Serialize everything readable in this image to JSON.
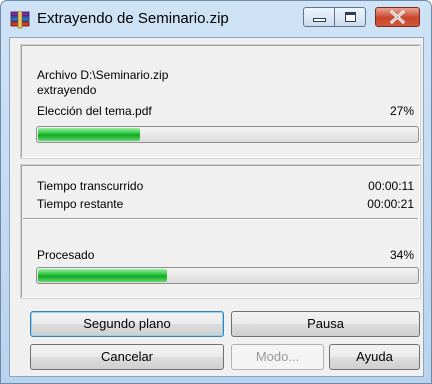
{
  "window": {
    "title": "Extrayendo de Seminario.zip"
  },
  "archive_line": "Archivo D:\\Seminario.zip",
  "action_line": "extrayendo",
  "current_file": {
    "name": "Elección del tema.pdf",
    "percent_label": "27%",
    "progress": 0.27
  },
  "times": {
    "elapsed_label": "Tiempo transcurrido",
    "elapsed_value": "00:00:11",
    "remaining_label": "Tiempo restante",
    "remaining_value": "00:00:21"
  },
  "total": {
    "label": "Procesado",
    "percent_label": "34%",
    "progress": 0.34
  },
  "buttons": {
    "background": "Segundo plano",
    "pause": "Pausa",
    "cancel": "Cancelar",
    "mode": "Modo...",
    "help": "Ayuda"
  },
  "icons": {
    "app": "winrar-books-icon",
    "minimize": "minimize-icon",
    "maximize": "maximize-icon",
    "close": "close-icon"
  },
  "colors": {
    "progress_fill": "#22c235",
    "close_button": "#c8452c",
    "title_bar": "#cfe3f6"
  }
}
